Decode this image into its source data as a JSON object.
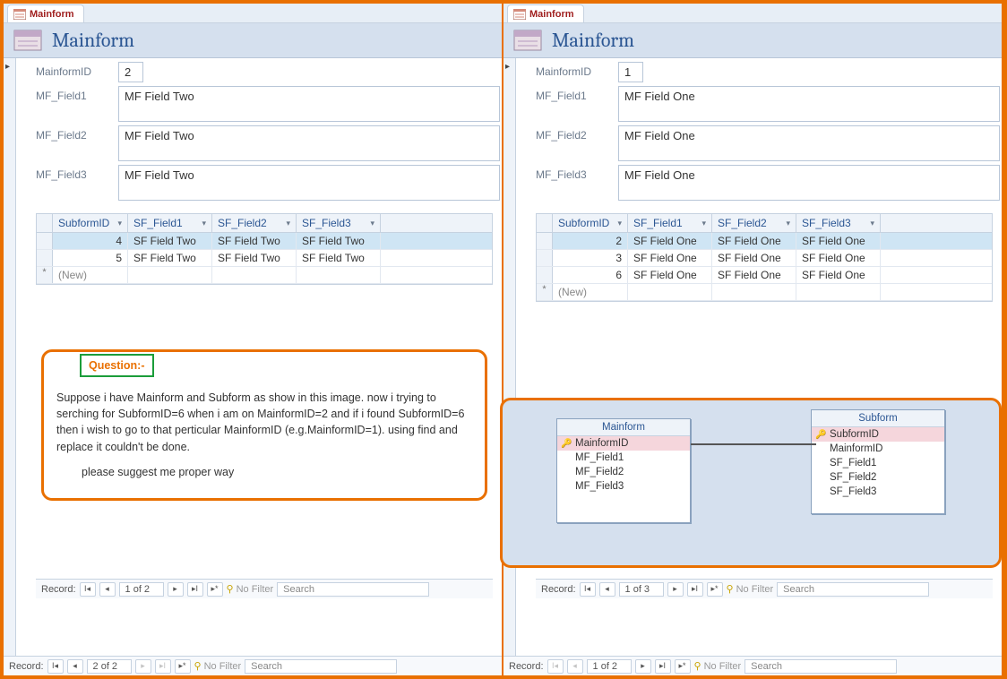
{
  "left": {
    "tab_label": "Mainform",
    "title": "Mainform",
    "fields": {
      "id_label": "MainformID",
      "id_value": "2",
      "f1_label": "MF_Field1",
      "f1_value": "MF Field Two",
      "f2_label": "MF_Field2",
      "f2_value": "MF Field Two",
      "f3_label": "MF_Field3",
      "f3_value": "MF Field Two"
    },
    "subform": {
      "headers": [
        "SubformID",
        "SF_Field1",
        "SF_Field2",
        "SF_Field3"
      ],
      "rows": [
        {
          "id": "4",
          "f1": "SF Field Two",
          "f2": "SF Field Two",
          "f3": "SF Field Two",
          "selected": true
        },
        {
          "id": "5",
          "f1": "SF Field Two",
          "f2": "SF Field Two",
          "f3": "SF Field Two",
          "selected": false
        }
      ],
      "new_label": "(New)",
      "recnav": {
        "label": "Record:",
        "pos": "1 of 2",
        "filter": "No Filter",
        "search": "Search"
      }
    },
    "outer_recnav": {
      "label": "Record:",
      "pos": "2 of 2",
      "filter": "No Filter",
      "search": "Search"
    }
  },
  "right": {
    "tab_label": "Mainform",
    "title": "Mainform",
    "fields": {
      "id_label": "MainformID",
      "id_value": "1",
      "f1_label": "MF_Field1",
      "f1_value": "MF Field One",
      "f2_label": "MF_Field2",
      "f2_value": "MF Field One",
      "f3_label": "MF_Field3",
      "f3_value": "MF Field One"
    },
    "subform": {
      "headers": [
        "SubformID",
        "SF_Field1",
        "SF_Field2",
        "SF_Field3"
      ],
      "rows": [
        {
          "id": "2",
          "f1": "SF Field One",
          "f2": "SF Field One",
          "f3": "SF Field One",
          "selected": true
        },
        {
          "id": "3",
          "f1": "SF Field One",
          "f2": "SF Field One",
          "f3": "SF Field One",
          "selected": false
        },
        {
          "id": "6",
          "f1": "SF Field One",
          "f2": "SF Field One",
          "f3": "SF Field One",
          "selected": false
        }
      ],
      "new_label": "(New)",
      "recnav": {
        "label": "Record:",
        "pos": "1 of 3",
        "filter": "No Filter",
        "search": "Search"
      }
    },
    "outer_recnav": {
      "label": "Record:",
      "pos": "1 of 2",
      "filter": "No Filter",
      "search": "Search"
    }
  },
  "question": {
    "title": "Question:-",
    "body1": "Suppose i have Mainform and Subform as show in this image. now i trying to serching for SubformID=6 when i am on MainformID=2 and if i found SubformID=6 then i wish to go to that perticular MainformID (e.g.MainformID=1). using find and replace it couldn't be done.",
    "body2": "please suggest me proper way"
  },
  "relationship": {
    "tables": [
      {
        "name": "Mainform",
        "fields": [
          "MainformID",
          "MF_Field1",
          "MF_Field2",
          "MF_Field3"
        ],
        "pk_index": 0
      },
      {
        "name": "Subform",
        "fields": [
          "SubformID",
          "MainformID",
          "SF_Field1",
          "SF_Field2",
          "SF_Field3"
        ],
        "pk_index": 0
      }
    ]
  }
}
